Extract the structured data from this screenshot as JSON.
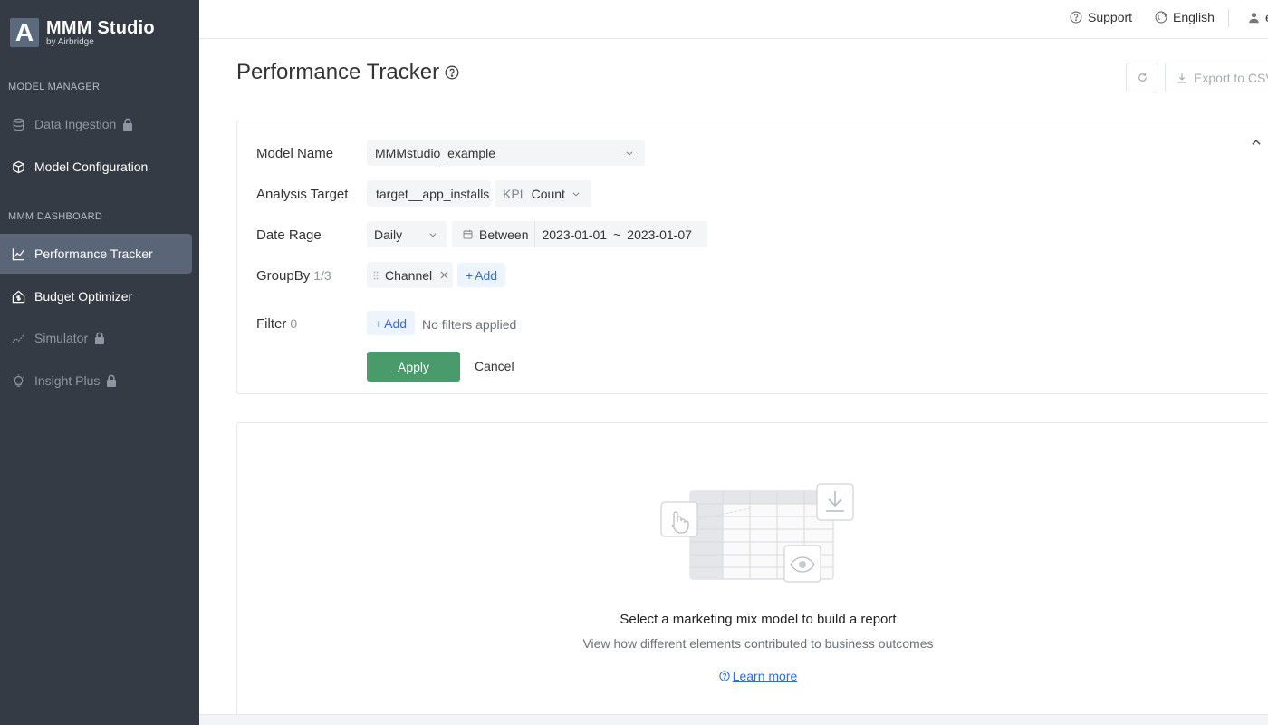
{
  "brand": {
    "title": "MMM Studio",
    "subtitle": "by Airbridge",
    "mark": "A"
  },
  "sidebar": {
    "sections": [
      {
        "label": "MODEL MANAGER"
      },
      {
        "label": "MMM DASHBOARD"
      }
    ],
    "items": [
      {
        "label": "Data Ingestion",
        "locked": true
      },
      {
        "label": "Model Configuration",
        "locked": false
      },
      {
        "label": "Performance Tracker",
        "locked": false,
        "active": true
      },
      {
        "label": "Budget Optimizer",
        "locked": false
      },
      {
        "label": "Simulator",
        "locked": true
      },
      {
        "label": "Insight Plus",
        "locked": true
      }
    ]
  },
  "topbar": {
    "support": "Support",
    "language": "English",
    "user": "e"
  },
  "page": {
    "title": "Performance Tracker",
    "export_label": "Export to CSV"
  },
  "filters": {
    "model_name_label": "Model Name",
    "model_name_value": "MMMstudio_example",
    "analysis_target_label": "Analysis Target",
    "analysis_target_value": "target__app_installs",
    "kpi_label": "KPI",
    "kpi_value": "Count",
    "date_range_label": "Date Rage",
    "date_granularity": "Daily",
    "date_mode": "Between",
    "date_start": "2023-01-01",
    "date_separator": "~",
    "date_end": "2023-01-07",
    "groupby_label": "GroupBy",
    "groupby_count": "1/3",
    "groupby_chip": "Channel",
    "add_label": "Add",
    "filter_label": "Filter",
    "filter_count": "0",
    "no_filters": "No filters applied",
    "apply_label": "Apply",
    "cancel_label": "Cancel"
  },
  "empty_state": {
    "title": "Select a marketing mix model to build a report",
    "subtitle": "View how different elements contributed to business outcomes",
    "learn_more": "Learn more"
  }
}
